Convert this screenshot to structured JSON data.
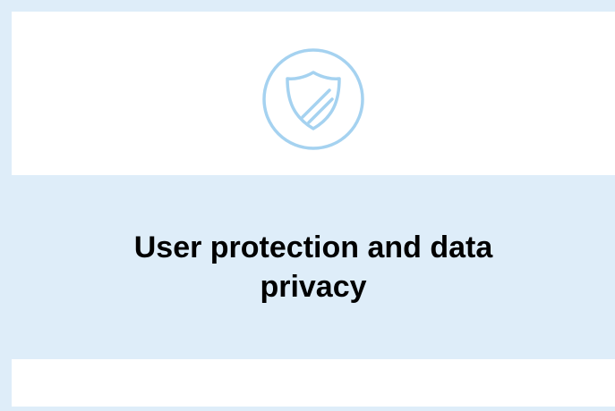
{
  "card": {
    "title": "User protection and data privacy",
    "icon": "shield-icon"
  },
  "colors": {
    "band": "#deedf9",
    "icon_stroke": "#a5d2f0",
    "title_text": "#000000"
  }
}
